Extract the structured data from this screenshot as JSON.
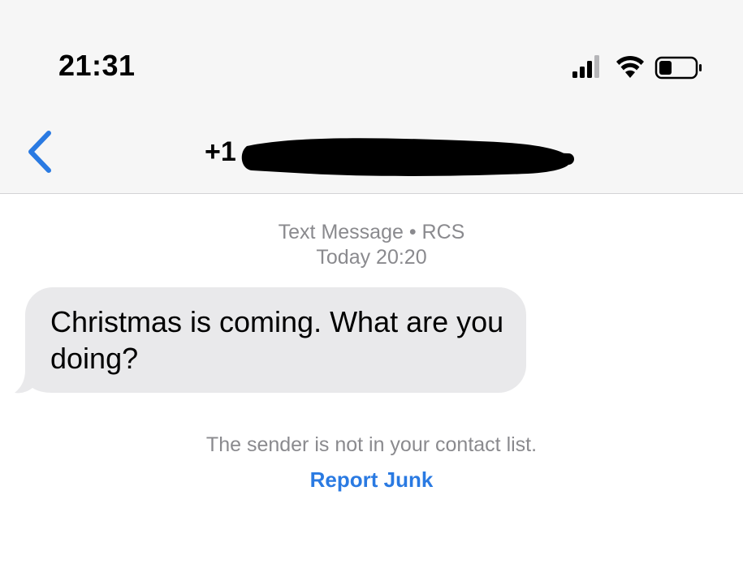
{
  "status_bar": {
    "time": "21:31"
  },
  "header": {
    "contact_prefix": "+1",
    "back_icon": "chevron-left-icon",
    "accent_color": "#2a7ae2"
  },
  "conversation": {
    "service_label": "Text Message • RCS",
    "timestamp": "Today 20:20",
    "messages": [
      {
        "direction": "incoming",
        "text": "Christmas is coming. What are you doing?"
      }
    ],
    "bubble_color": "#e9e9eb"
  },
  "junk_notice": {
    "text": "The sender is not in your contact list.",
    "action_label": "Report Junk"
  }
}
